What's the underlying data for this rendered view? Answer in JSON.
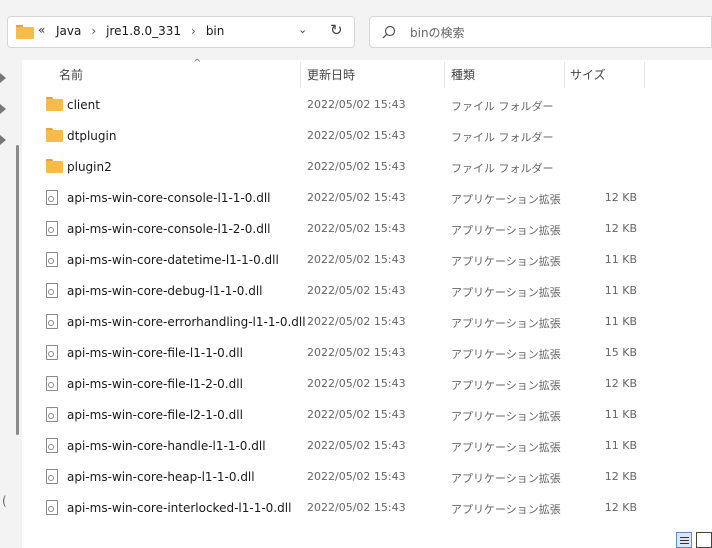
{
  "address": {
    "back_glyph": "«",
    "crumbs": [
      "Java",
      "jre1.8.0_331",
      "bin"
    ],
    "separator": "›"
  },
  "search": {
    "placeholder": "binの検索"
  },
  "columns": {
    "name": "名前",
    "date": "更新日時",
    "type": "種類",
    "size": "サイズ"
  },
  "files": [
    {
      "name": "client",
      "date": "2022/05/02 15:43",
      "type": "ファイル フォルダー",
      "size": "",
      "icon": "folder-icon"
    },
    {
      "name": "dtplugin",
      "date": "2022/05/02 15:43",
      "type": "ファイル フォルダー",
      "size": "",
      "icon": "folder-icon"
    },
    {
      "name": "plugin2",
      "date": "2022/05/02 15:43",
      "type": "ファイル フォルダー",
      "size": "",
      "icon": "folder-icon"
    },
    {
      "name": "api-ms-win-core-console-l1-1-0.dll",
      "date": "2022/05/02 15:43",
      "type": "アプリケーション拡張",
      "size": "12 KB",
      "icon": "dll-file-icon"
    },
    {
      "name": "api-ms-win-core-console-l1-2-0.dll",
      "date": "2022/05/02 15:43",
      "type": "アプリケーション拡張",
      "size": "12 KB",
      "icon": "dll-file-icon"
    },
    {
      "name": "api-ms-win-core-datetime-l1-1-0.dll",
      "date": "2022/05/02 15:43",
      "type": "アプリケーション拡張",
      "size": "11 KB",
      "icon": "dll-file-icon"
    },
    {
      "name": "api-ms-win-core-debug-l1-1-0.dll",
      "date": "2022/05/02 15:43",
      "type": "アプリケーション拡張",
      "size": "11 KB",
      "icon": "dll-file-icon"
    },
    {
      "name": "api-ms-win-core-errorhandling-l1-1-0.dll",
      "date": "2022/05/02 15:43",
      "type": "アプリケーション拡張",
      "size": "11 KB",
      "icon": "dll-file-icon"
    },
    {
      "name": "api-ms-win-core-file-l1-1-0.dll",
      "date": "2022/05/02 15:43",
      "type": "アプリケーション拡張",
      "size": "15 KB",
      "icon": "dll-file-icon"
    },
    {
      "name": "api-ms-win-core-file-l1-2-0.dll",
      "date": "2022/05/02 15:43",
      "type": "アプリケーション拡張",
      "size": "12 KB",
      "icon": "dll-file-icon"
    },
    {
      "name": "api-ms-win-core-file-l2-1-0.dll",
      "date": "2022/05/02 15:43",
      "type": "アプリケーション拡張",
      "size": "11 KB",
      "icon": "dll-file-icon"
    },
    {
      "name": "api-ms-win-core-handle-l1-1-0.dll",
      "date": "2022/05/02 15:43",
      "type": "アプリケーション拡張",
      "size": "11 KB",
      "icon": "dll-file-icon"
    },
    {
      "name": "api-ms-win-core-heap-l1-1-0.dll",
      "date": "2022/05/02 15:43",
      "type": "アプリケーション拡張",
      "size": "12 KB",
      "icon": "dll-file-icon"
    },
    {
      "name": "api-ms-win-core-interlocked-l1-1-0.dll",
      "date": "2022/05/02 15:43",
      "type": "アプリケーション拡張",
      "size": "12 KB",
      "icon": "dll-file-icon"
    }
  ],
  "nav_partial_label": "(",
  "colors": {
    "folder": "#f5bd45",
    "accent": "#5b8dc9",
    "background": "#f3f3f3"
  }
}
